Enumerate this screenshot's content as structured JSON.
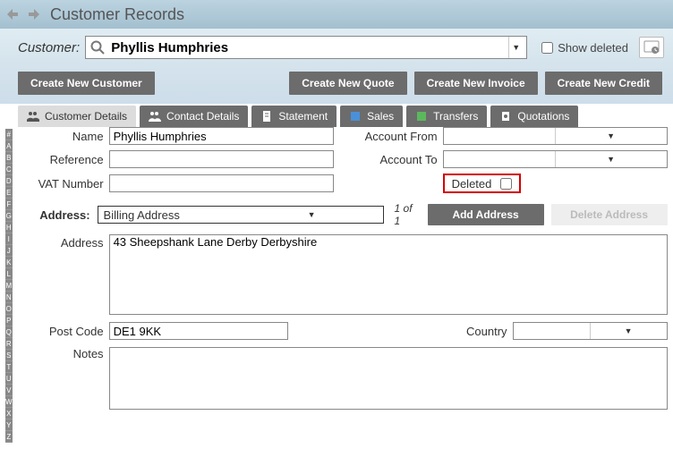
{
  "header": {
    "title": "Customer Records"
  },
  "search": {
    "label": "Customer:",
    "value": "Phyllis Humphries",
    "show_deleted_label": "Show deleted"
  },
  "actions": {
    "create_customer": "Create New Customer",
    "create_quote": "Create New Quote",
    "create_invoice": "Create New Invoice",
    "create_credit": "Create New Credit"
  },
  "tabs": {
    "details": "Customer Details",
    "contact": "Contact Details",
    "statement": "Statement",
    "sales": "Sales",
    "transfers": "Transfers",
    "quotations": "Quotations"
  },
  "form": {
    "name_label": "Name",
    "name_value": "Phyllis Humphries",
    "reference_label": "Reference",
    "reference_value": "",
    "vat_label": "VAT Number",
    "vat_value": "",
    "account_from_label": "Account From",
    "account_from_value": "",
    "account_to_label": "Account To",
    "account_to_value": "",
    "deleted_label": "Deleted"
  },
  "address": {
    "heading": "Address:",
    "selector_value": "Billing Address",
    "count": "1 of 1",
    "add_btn": "Add Address",
    "delete_btn": "Delete Address",
    "address_label": "Address",
    "address_value": "43 Sheepshank Lane Derby Derbyshire",
    "postcode_label": "Post Code",
    "postcode_value": "DE1 9KK",
    "country_label": "Country",
    "country_value": "",
    "notes_label": "Notes",
    "notes_value": ""
  },
  "alpha": [
    "#",
    "A",
    "B",
    "C",
    "D",
    "E",
    "F",
    "G",
    "H",
    "I",
    "J",
    "K",
    "L",
    "M",
    "N",
    "O",
    "P",
    "Q",
    "R",
    "S",
    "T",
    "U",
    "V",
    "W",
    "X",
    "Y",
    "Z"
  ]
}
